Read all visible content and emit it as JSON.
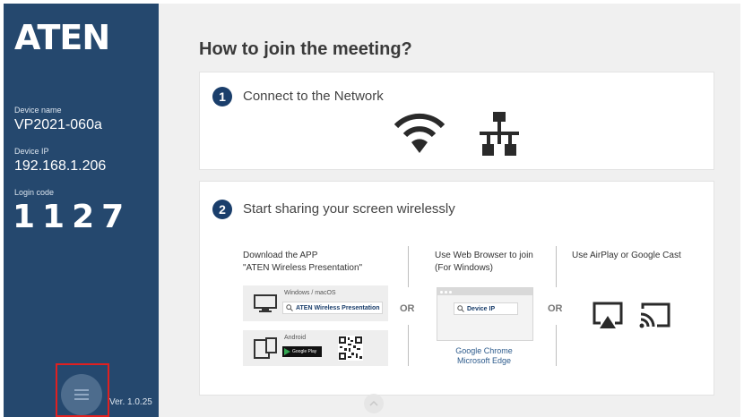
{
  "sidebar": {
    "brand": "ATEN",
    "device_name_label": "Device name",
    "device_name": "VP2021-060a",
    "device_ip_label": "Device IP",
    "device_ip": "192.168.1.206",
    "login_code_label": "Login code",
    "login_code": "1127",
    "version": "Ver. 1.0.25"
  },
  "main": {
    "title": "How to join the meeting?",
    "step1": {
      "number": "1",
      "title": "Connect to the Network"
    },
    "step2": {
      "number": "2",
      "title": "Start sharing your screen wirelessly",
      "app": {
        "line1": "Download the APP",
        "line2": "\"ATEN Wireless Presentation\"",
        "windows_label": "Windows / macOS",
        "windows_search": "ATEN Wireless Presentation",
        "android_label": "Android",
        "google_play": "Google Play"
      },
      "or": "OR",
      "browser": {
        "line1": "Use Web Browser to join",
        "line2": "(For Windows)",
        "search": "Device IP",
        "chrome": "Google Chrome",
        "edge": "Microsoft Edge"
      },
      "cast": {
        "label": "Use AirPlay or Google Cast"
      }
    }
  },
  "colors": {
    "sidebar": "#25486e",
    "accent": "#1a3e6b",
    "link": "#2d5b8c",
    "highlight": "#e02020"
  },
  "icons": [
    "wifi-icon",
    "network-icon",
    "monitor-icon",
    "search-icon",
    "tablet-phone-icon",
    "qr-code-icon",
    "google-play-icon",
    "airplay-icon",
    "google-cast-icon",
    "menu-icon",
    "chevron-up-icon"
  ]
}
